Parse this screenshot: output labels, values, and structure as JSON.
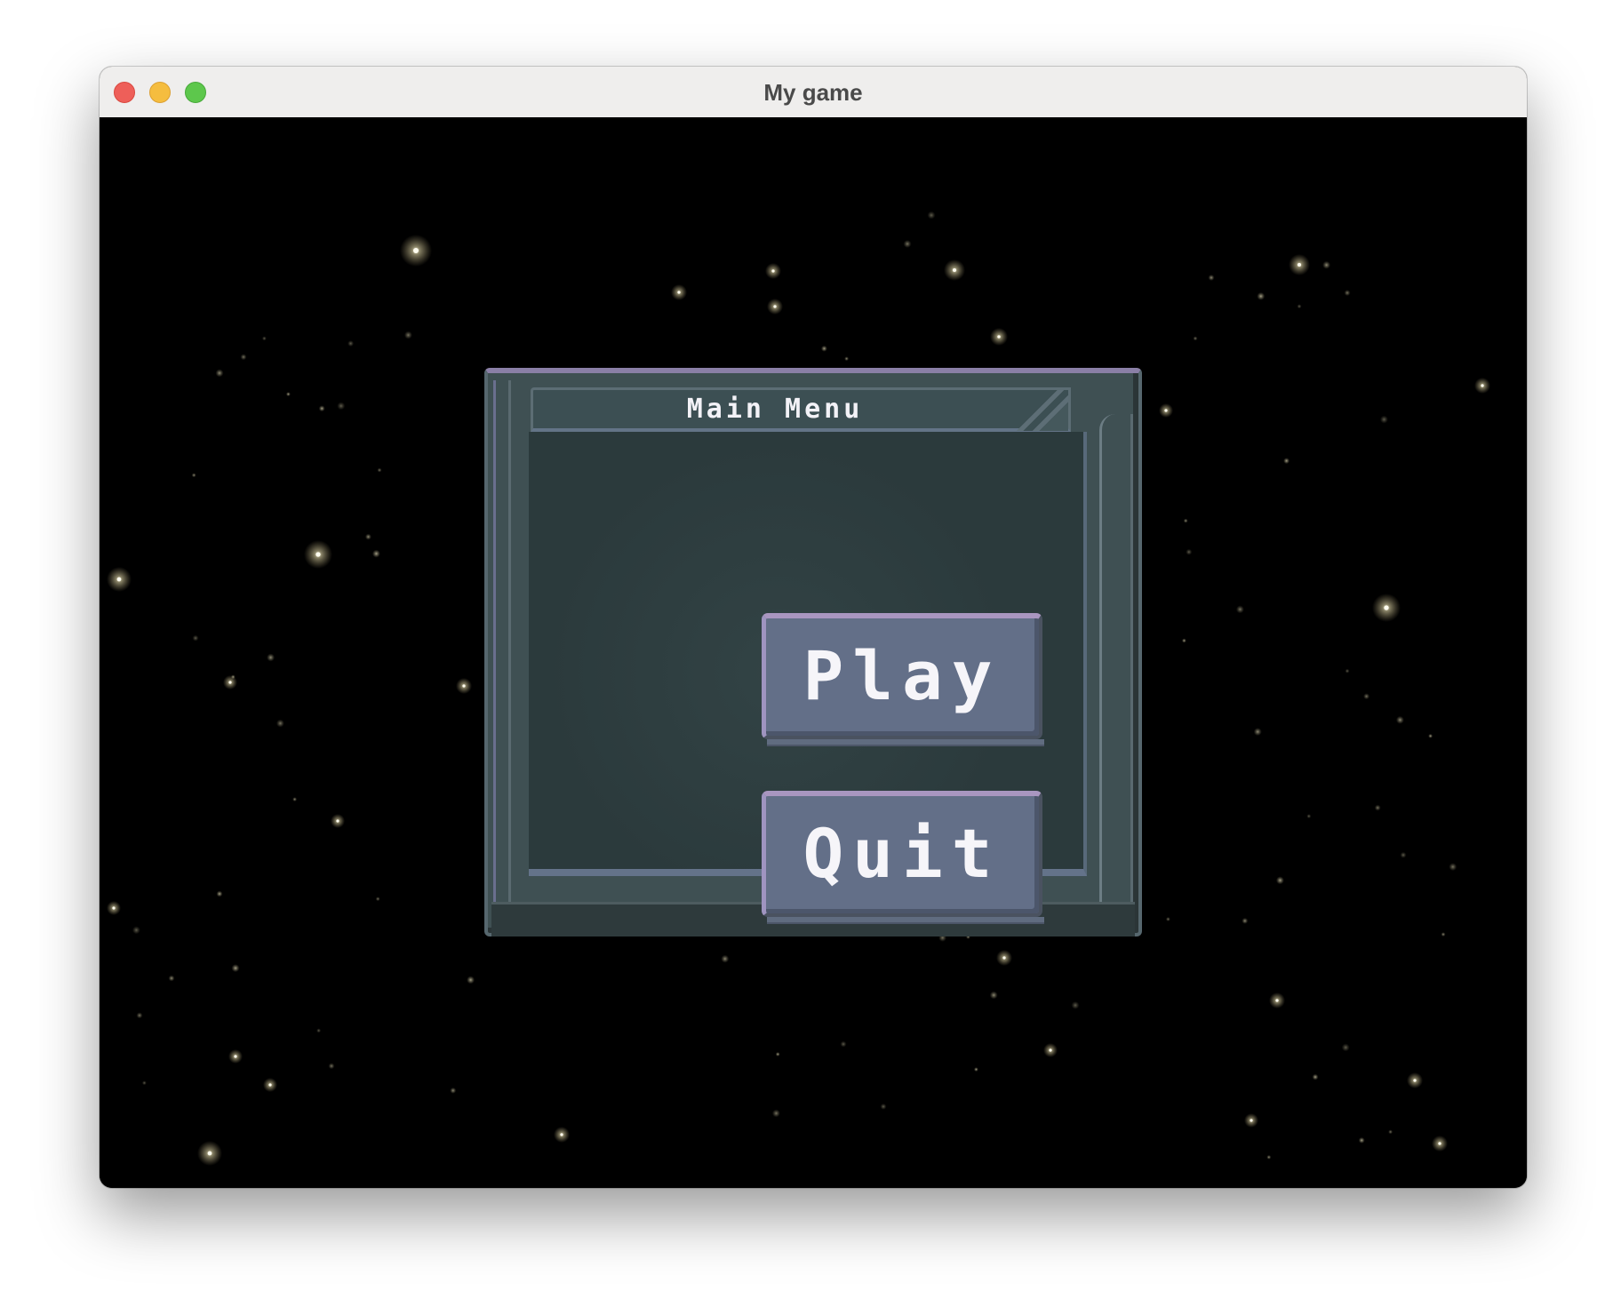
{
  "window": {
    "title": "My game",
    "controls": [
      "close",
      "minimize",
      "maximize"
    ]
  },
  "menu": {
    "title": "Main Menu",
    "buttons": [
      {
        "label": "Play"
      },
      {
        "label": "Quit"
      }
    ]
  },
  "colors": {
    "panel": "#3f5053",
    "panel_inner": "#2b3a3c",
    "button_face": "#636f88",
    "button_highlight": "#a996c0",
    "text": "#f6f5f9",
    "background": "#000000"
  }
}
